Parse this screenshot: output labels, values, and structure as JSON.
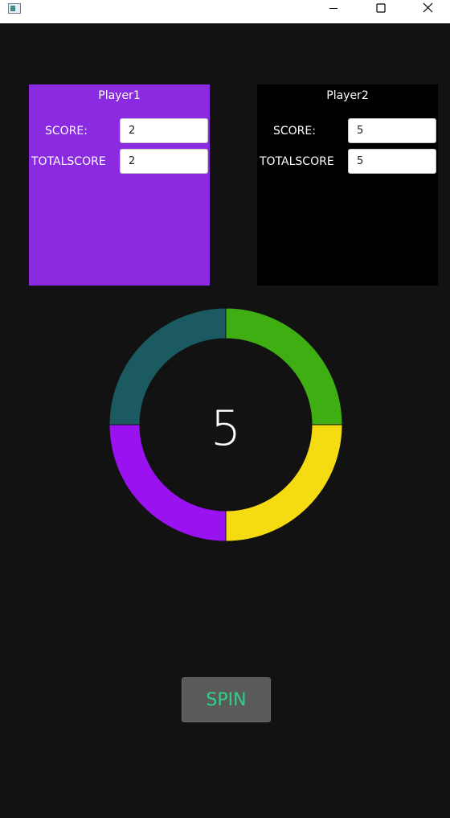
{
  "colors": {
    "background": "#121212",
    "player1_panel": "#8a2be2",
    "player2_panel": "#000000",
    "wheel_teal": "#1b5a60",
    "wheel_green": "#3fae12",
    "wheel_yellow": "#f5dc12",
    "wheel_purple": "#9a12ef",
    "spin_text": "#2fd18a"
  },
  "window": {
    "icons": [
      "app-icon",
      "minimize-icon",
      "maximize-icon",
      "close-icon"
    ]
  },
  "players": [
    {
      "name": "Player1",
      "score_label": "SCORE:",
      "score": "2",
      "total_label": "TOTALSCORE",
      "total": "2"
    },
    {
      "name": "Player2",
      "score_label": "SCORE:",
      "score": "5",
      "total_label": "TOTALSCORE",
      "total": "5"
    }
  ],
  "wheel": {
    "value": "5",
    "segments": [
      "teal",
      "green",
      "yellow",
      "purple"
    ]
  },
  "spin": {
    "label": "SPIN"
  }
}
